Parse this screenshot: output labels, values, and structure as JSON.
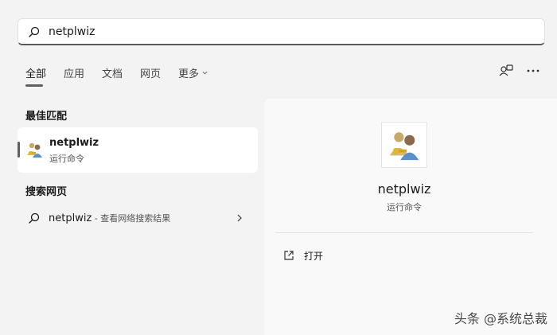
{
  "search": {
    "value": "netplwiz"
  },
  "tabs": [
    {
      "label": "全部"
    },
    {
      "label": "应用"
    },
    {
      "label": "文档"
    },
    {
      "label": "网页"
    },
    {
      "label": "更多"
    }
  ],
  "sections": {
    "best_match": "最佳匹配",
    "search_web": "搜索网页"
  },
  "best_match": {
    "title": "netplwiz",
    "subtitle": "运行命令"
  },
  "web_result": {
    "query": "netplwiz",
    "hint": " - 查看网络搜索结果"
  },
  "detail": {
    "name": "netplwiz",
    "type": "运行命令",
    "actions": [
      {
        "label": "打开"
      }
    ]
  },
  "watermark": "头条 @系统总裁",
  "colors": {
    "accent": "#5f5f5f",
    "background": "#f3f3f3",
    "panel": "#f9f9f9"
  }
}
